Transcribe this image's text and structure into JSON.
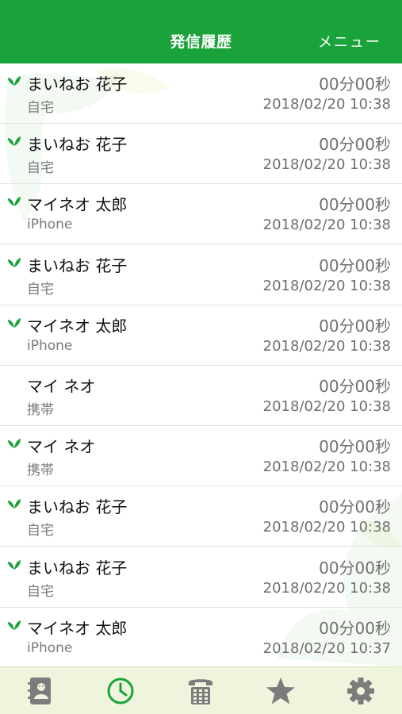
{
  "header": {
    "title": "発信履歴",
    "menu_label": "メニュー"
  },
  "colors": {
    "accent": "#1aa33a",
    "tabbar_bg": "#eef5dc",
    "icon_gray": "#7c7c7c"
  },
  "calls": [
    {
      "name": "まいねお 花子",
      "type": "自宅",
      "duration": "00分00秒",
      "datetime": "2018/02/20 10:38",
      "marked": true
    },
    {
      "name": "まいねお 花子",
      "type": "自宅",
      "duration": "00分00秒",
      "datetime": "2018/02/20 10:38",
      "marked": true
    },
    {
      "name": "マイネオ 太郎",
      "type": "iPhone",
      "duration": "00分00秒",
      "datetime": "2018/02/20 10:38",
      "marked": true
    },
    {
      "name": "まいねお 花子",
      "type": "自宅",
      "duration": "00分00秒",
      "datetime": "2018/02/20 10:38",
      "marked": true
    },
    {
      "name": "マイネオ 太郎",
      "type": "iPhone",
      "duration": "00分00秒",
      "datetime": "2018/02/20 10:38",
      "marked": true
    },
    {
      "name": "マイ ネオ",
      "type": "携帯",
      "duration": "00分00秒",
      "datetime": "2018/02/20 10:38",
      "marked": false
    },
    {
      "name": "マイ ネオ",
      "type": "携帯",
      "duration": "00分00秒",
      "datetime": "2018/02/20 10:38",
      "marked": true
    },
    {
      "name": "まいねお 花子",
      "type": "自宅",
      "duration": "00分00秒",
      "datetime": "2018/02/20 10:38",
      "marked": true
    },
    {
      "name": "まいねお 花子",
      "type": "自宅",
      "duration": "00分00秒",
      "datetime": "2018/02/20 10:38",
      "marked": true
    },
    {
      "name": "マイネオ 太郎",
      "type": "iPhone",
      "duration": "00分00秒",
      "datetime": "2018/02/20 10:37",
      "marked": true
    }
  ],
  "tabs": [
    {
      "icon": "contacts-icon",
      "active": false
    },
    {
      "icon": "history-clock-icon",
      "active": true
    },
    {
      "icon": "keypad-phone-icon",
      "active": false
    },
    {
      "icon": "favorites-star-icon",
      "active": false
    },
    {
      "icon": "settings-gear-icon",
      "active": false
    }
  ]
}
